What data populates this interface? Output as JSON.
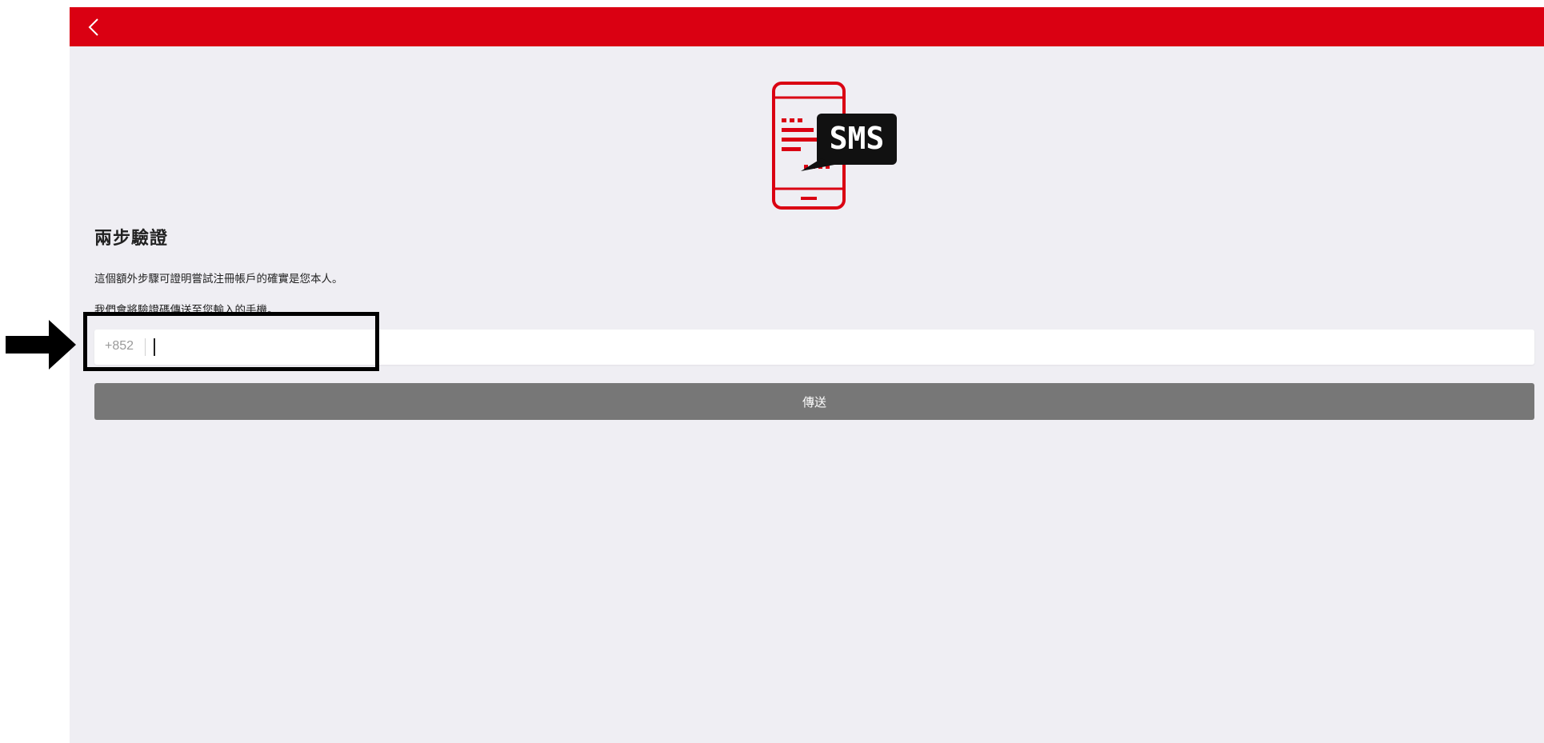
{
  "header": {
    "back_icon": "chevron-left-icon",
    "background_color": "#da0012"
  },
  "hero": {
    "icon": "sms-phone-icon",
    "badge_text": "SMS"
  },
  "title": "兩步驗證",
  "description_line1": "這個額外步驟可證明嘗試注冊帳戶的確實是您本人。",
  "description_line2": "我們會將驗證碼傳送至您輸入的手機。",
  "phone": {
    "country_code": "+852",
    "value": ""
  },
  "send_button": {
    "label": "傳送",
    "color": "#777777"
  },
  "annotation": {
    "arrow_icon": "arrow-right-icon"
  }
}
